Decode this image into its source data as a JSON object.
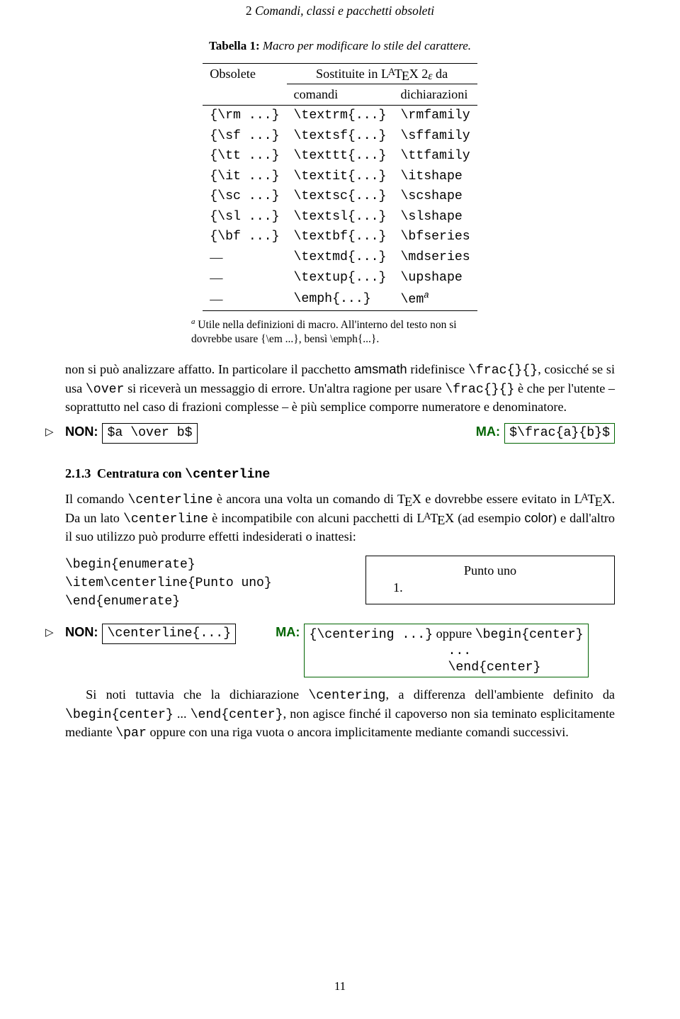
{
  "running_head": {
    "num": "2",
    "text": "Comandi, classi e pacchetti obsoleti"
  },
  "table": {
    "caption_label": "Tabella 1:",
    "caption_text": "Macro per modificare lo stile del carattere.",
    "head_obsolete": "Obsolete",
    "head_replace_prefix": "Sostituite in ",
    "head_replace_suffix": " da",
    "sub_commands": "comandi",
    "sub_decls": "dichiarazioni",
    "rows": [
      {
        "obs": "{\\rm ...}",
        "cmd": "\\textrm{...}",
        "decl": "\\rmfamily"
      },
      {
        "obs": "{\\sf ...}",
        "cmd": "\\textsf{...}",
        "decl": "\\sffamily"
      },
      {
        "obs": "{\\tt ...}",
        "cmd": "\\texttt{...}",
        "decl": "\\ttfamily"
      },
      {
        "obs": "{\\it ...}",
        "cmd": "\\textit{...}",
        "decl": "\\itshape"
      },
      {
        "obs": "{\\sc ...}",
        "cmd": "\\textsc{...}",
        "decl": "\\scshape"
      },
      {
        "obs": "{\\sl ...}",
        "cmd": "\\textsl{...}",
        "decl": "\\slshape"
      },
      {
        "obs": "{\\bf ...}",
        "cmd": "\\textbf{...}",
        "decl": "\\bfseries"
      },
      {
        "obs": "—",
        "cmd": "\\textmd{...}",
        "decl": "\\mdseries"
      },
      {
        "obs": "—",
        "cmd": "\\textup{...}",
        "decl": "\\upshape"
      },
      {
        "obs": "—",
        "cmd": "\\emph{...}",
        "decl": "\\em"
      }
    ],
    "footnote_mark": "a",
    "footnote": "Utile nella definizioni di macro. All'interno del testo non si dovrebbe usare {\\em ...}, bensì \\emph{...}."
  },
  "para1_a": "non si può analizzare affatto. In particolare il pacchetto ",
  "para1_b": " ridefinisce ",
  "para1_c": ", cosicché se si usa ",
  "para1_d": " si riceverà un messaggio di errore. Un'altra ragione per usare ",
  "para1_e": " è che per l'utente – soprattutto nel caso di frazioni complesse – è più semplice comporre numeratore e denominatore.",
  "amsmath": "amsmath",
  "frac": "\\frac{}{}",
  "over": "\\over",
  "non": "NON:",
  "ma": "MA:",
  "non_code1": "$a \\over b$",
  "ma_code1": "$\\frac{a}{b}$",
  "sec213_no": "2.1.3",
  "sec213_title_a": "Centratura con ",
  "sec213_title_b": "\\centerline",
  "p213_a": "Il comando ",
  "p213_b": " è ancora una volta un comando di ",
  "p213_c": " e dovrebbe essere evitato in ",
  "p213_d": ". Da un lato ",
  "p213_e": " è incompatibile con alcuni pacchetti di ",
  "p213_f": " (ad esempio ",
  "p213_g": ") e dall'altro il suo utilizzo può produrre effetti indesiderati o inattesi:",
  "centerline": "\\centerline",
  "color_pkg": "color",
  "code_block": "\\begin{enumerate}\n\\item\\centerline{Punto uno}\n\\end{enumerate}",
  "output_title": "Punto uno",
  "output_item": "1.",
  "non_code2": "\\centerline{...}",
  "ma_code2_l1": "{\\centering ...}",
  "ma_code2_mid": " oppure ",
  "ma_code2_l1b": "\\begin{center}",
  "ma_code2_l2a": "... ",
  "ma_code2_l2b": "\\end{center}",
  "p_final_a": "Si noti tuttavia che la dichiarazione ",
  "p_final_b": ", a differenza dell'ambiente definito da ",
  "p_final_c": " ... ",
  "p_final_d": ", non agisce finché il capoverso non sia teminato esplicitamente mediante ",
  "p_final_e": " oppure con una riga vuota o ancora implicitamente mediante comandi successivi.",
  "centering": "\\centering",
  "begincenter": "\\begin{center}",
  "endcenter": "\\end{center}",
  "par": "\\par",
  "pageno": "11"
}
